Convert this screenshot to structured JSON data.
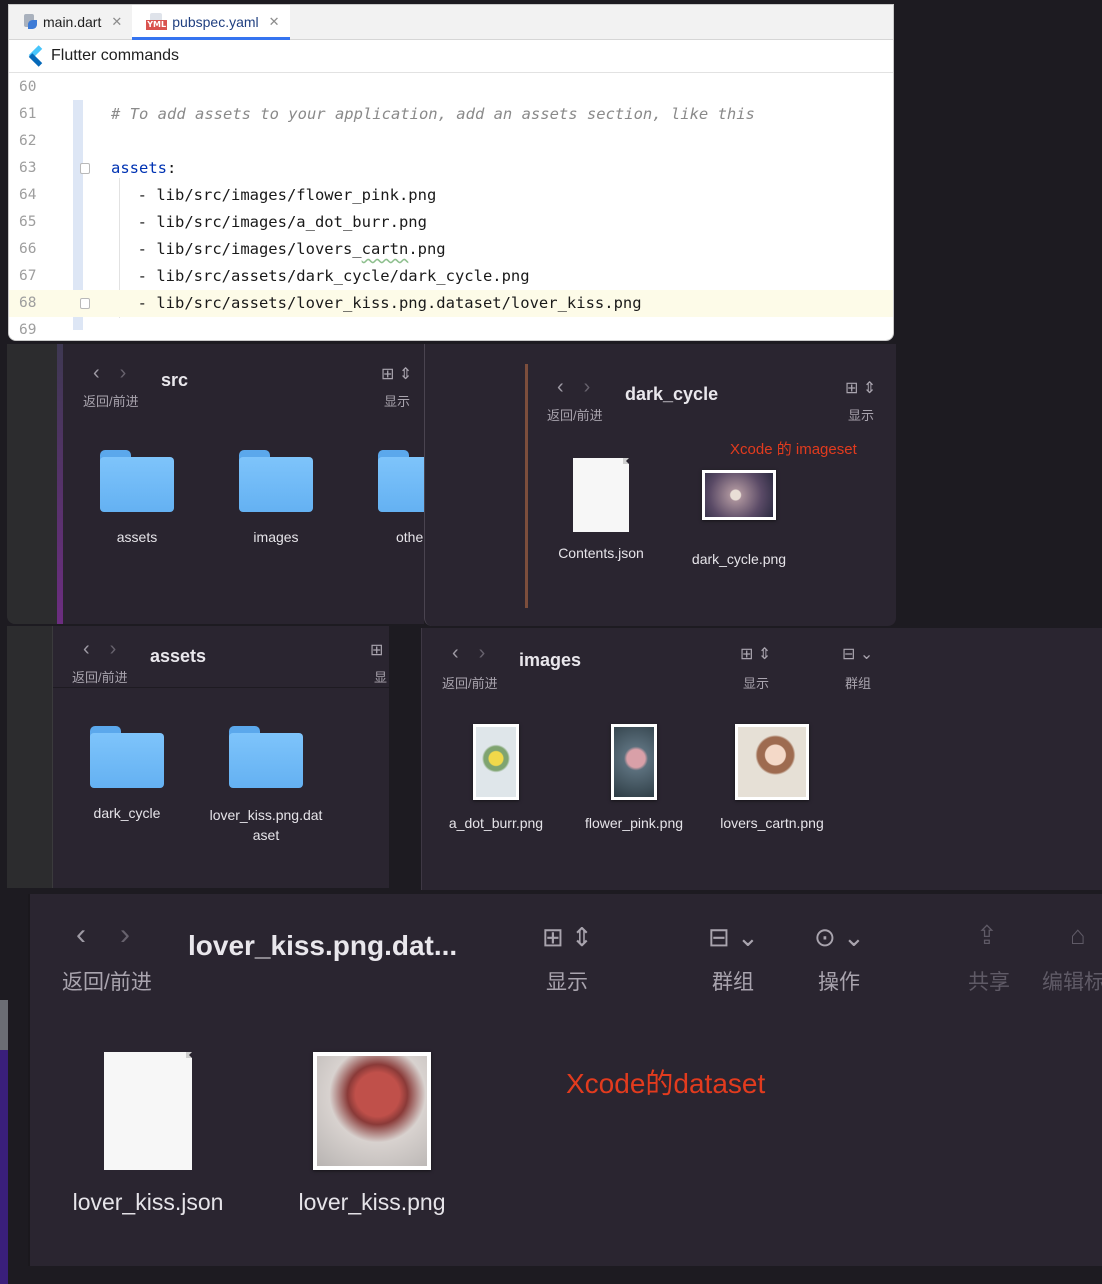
{
  "ide": {
    "tabs": [
      {
        "label": "main.dart",
        "active": false
      },
      {
        "label": "pubspec.yaml",
        "active": true
      }
    ],
    "yml_badge": "YML",
    "commands_label": "Flutter commands",
    "lines": [
      {
        "num": "60",
        "text": ""
      },
      {
        "num": "61",
        "text": "# To add assets to your application, add an assets section, like this"
      },
      {
        "num": "62",
        "text": ""
      },
      {
        "num": "63",
        "key": "assets",
        "text": ":"
      },
      {
        "num": "64",
        "text": "  - lib/src/images/flower_pink.png"
      },
      {
        "num": "65",
        "text": "  - lib/src/images/a_dot_burr.png"
      },
      {
        "num": "66",
        "text_before": "  - lib/src/images/lovers_",
        "text_wavy": "cartn",
        "text_after": ".png"
      },
      {
        "num": "67",
        "text": "  - lib/src/assets/dark_cycle/dark_cycle.png"
      },
      {
        "num": "68",
        "text": "  - lib/src/assets/lover_kiss.png.dataset/lover_kiss.png"
      },
      {
        "num": "69",
        "text": ""
      }
    ]
  },
  "finder_common": {
    "nav_label": "返回/前进",
    "view_label": "显示",
    "group_label": "群组",
    "action_label": "操作",
    "share_label": "共享",
    "edit_tags_label": "编辑标"
  },
  "src_window": {
    "title": "src",
    "items": [
      "assets",
      "images",
      "othe"
    ]
  },
  "dark_window": {
    "title": "dark_cycle",
    "note": "Xcode 的 imageset",
    "items": [
      "Contents.json",
      "dark_cycle.png"
    ]
  },
  "assets_window": {
    "title": "assets",
    "view_label_partial": "显",
    "items": [
      "dark_cycle",
      "lover_kiss.png.dat\naset"
    ]
  },
  "images_window": {
    "title": "images",
    "items": [
      "a_dot_burr.png",
      "flower_pink.png",
      "lovers_cartn.png"
    ]
  },
  "dataset_window": {
    "title": "lover_kiss.png.dat...",
    "note": "Xcode的dataset",
    "items": [
      "lover_kiss.json",
      "lover_kiss.png"
    ]
  }
}
